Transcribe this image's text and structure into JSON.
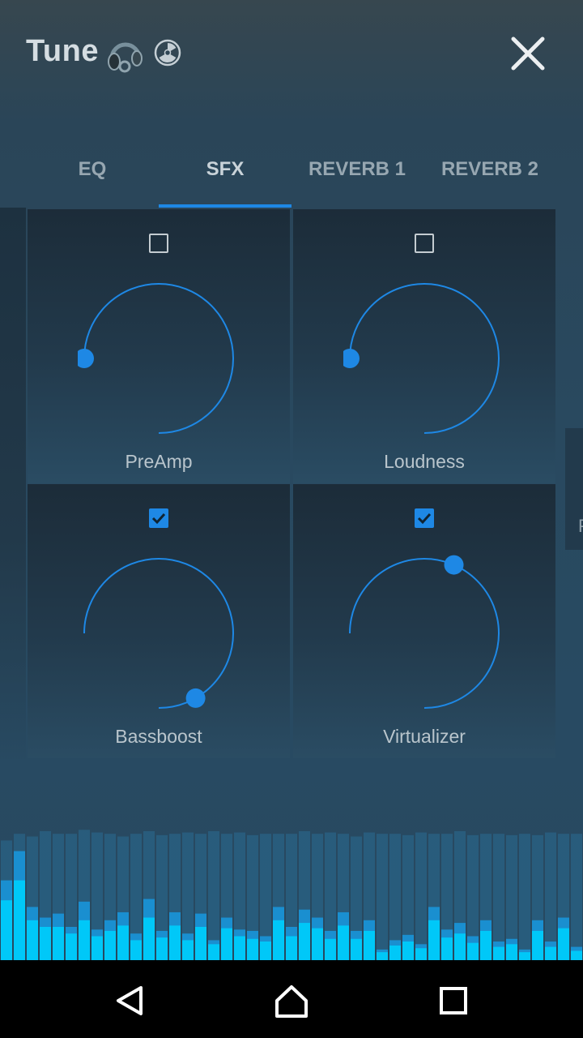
{
  "header": {
    "title": "Tune",
    "icons": [
      "headphones-icon",
      "radiation-icon",
      "close-icon"
    ]
  },
  "tabs": [
    {
      "label": "EQ",
      "active": false
    },
    {
      "label": "SFX",
      "active": true
    },
    {
      "label": "REVERB 1",
      "active": false
    },
    {
      "label": "REVERB 2",
      "active": false
    }
  ],
  "side_panel_right": {
    "label": "P"
  },
  "effects": [
    {
      "label": "PreAmp",
      "enabled": false,
      "level": 0.0
    },
    {
      "label": "Loudness",
      "enabled": false,
      "level": 0.0
    },
    {
      "label": "Bassboost",
      "enabled": true,
      "level": 0.89
    },
    {
      "label": "Virtualizer",
      "enabled": true,
      "level": 0.42
    }
  ],
  "colors": {
    "accent": "#1e88e5",
    "background": "#284a62",
    "spectrum_peak": "#2a6c94",
    "spectrum_bar_bright": "#00c8f8"
  },
  "spectrum": {
    "peak_levels": [
      0.9,
      0.95,
      0.93,
      0.97,
      0.95,
      0.95,
      0.98,
      0.96,
      0.95,
      0.93,
      0.95,
      0.97,
      0.94,
      0.95,
      0.96,
      0.95,
      0.97,
      0.95,
      0.96,
      0.94,
      0.95,
      0.95,
      0.95,
      0.97,
      0.95,
      0.96,
      0.95,
      0.93,
      0.96,
      0.95,
      0.95,
      0.94,
      0.96,
      0.95,
      0.95,
      0.97,
      0.94,
      0.95,
      0.95,
      0.94,
      0.95,
      0.94,
      0.96,
      0.95,
      0.95
    ],
    "bar_levels": [
      0.6,
      0.82,
      0.4,
      0.32,
      0.35,
      0.25,
      0.44,
      0.23,
      0.3,
      0.36,
      0.2,
      0.46,
      0.22,
      0.36,
      0.2,
      0.35,
      0.15,
      0.32,
      0.23,
      0.22,
      0.18,
      0.4,
      0.25,
      0.38,
      0.32,
      0.22,
      0.36,
      0.22,
      0.3,
      0.08,
      0.15,
      0.19,
      0.12,
      0.4,
      0.23,
      0.28,
      0.18,
      0.3,
      0.14,
      0.16,
      0.08,
      0.3,
      0.14,
      0.32,
      0.1
    ],
    "mid_levels": [
      0.45,
      0.6,
      0.3,
      0.25,
      0.25,
      0.2,
      0.3,
      0.18,
      0.22,
      0.26,
      0.15,
      0.32,
      0.17,
      0.26,
      0.15,
      0.25,
      0.12,
      0.24,
      0.18,
      0.16,
      0.14,
      0.3,
      0.18,
      0.28,
      0.24,
      0.16,
      0.26,
      0.16,
      0.22,
      0.06,
      0.11,
      0.14,
      0.09,
      0.3,
      0.17,
      0.2,
      0.13,
      0.22,
      0.1,
      0.12,
      0.06,
      0.22,
      0.1,
      0.24,
      0.07
    ]
  },
  "nav": {
    "buttons": [
      "back-icon",
      "home-icon",
      "recents-icon"
    ]
  }
}
